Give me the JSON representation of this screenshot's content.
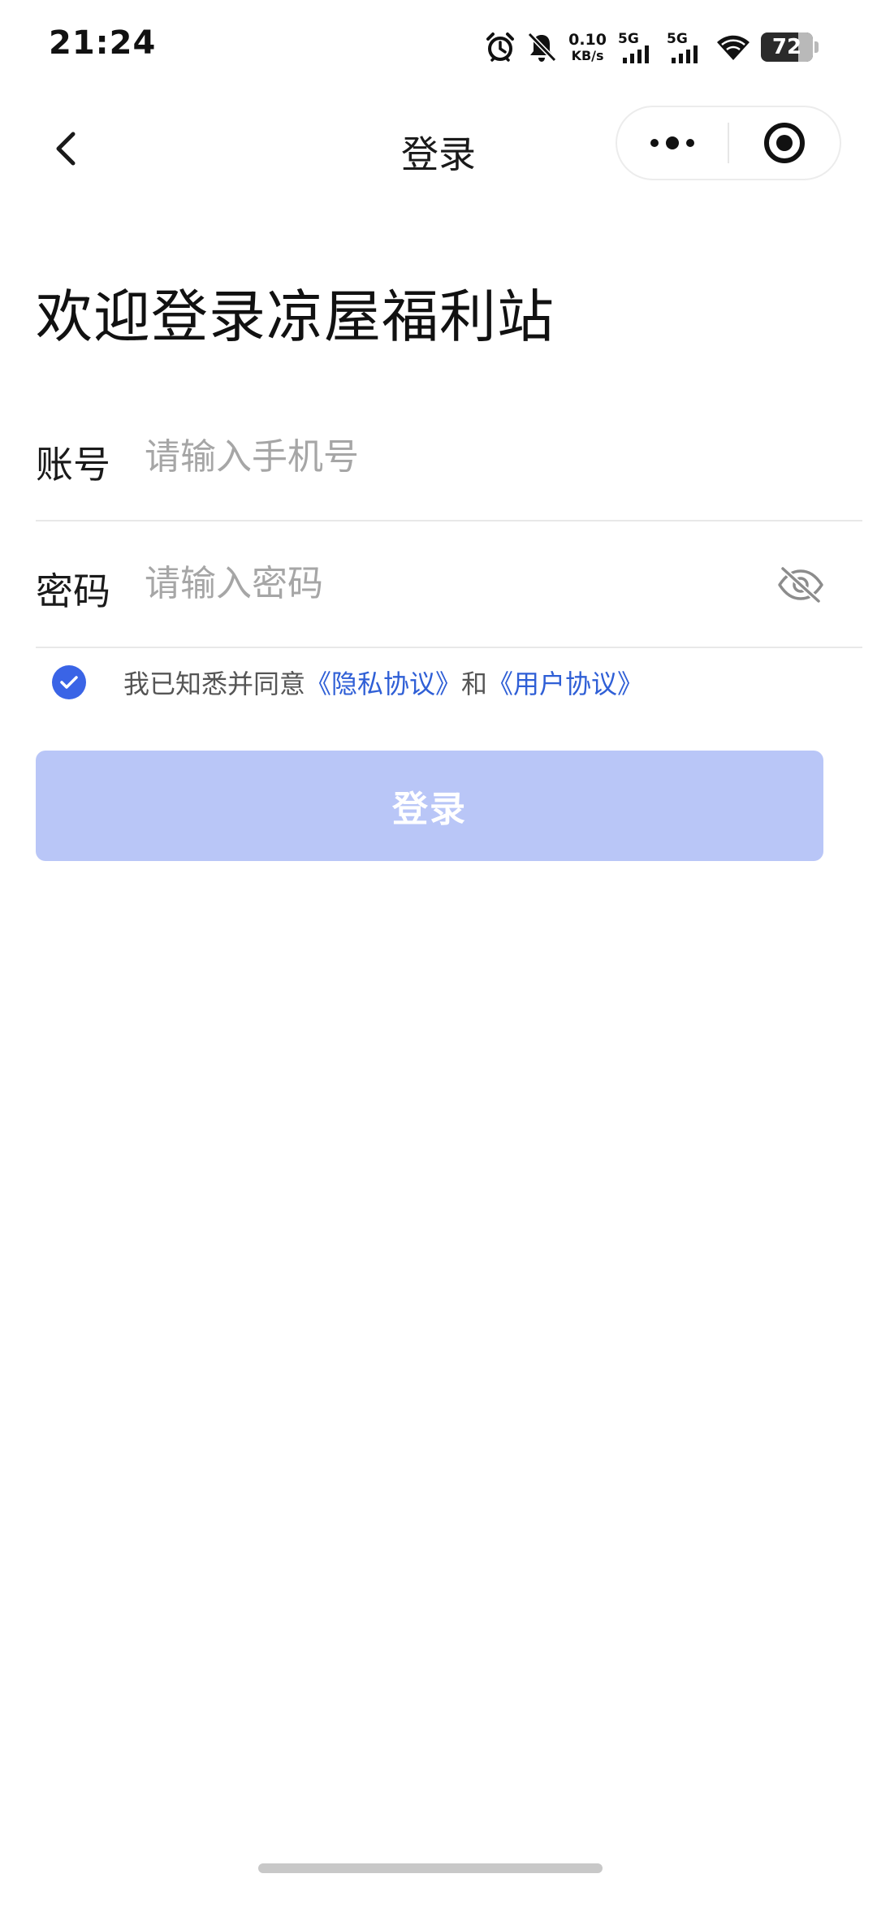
{
  "status_bar": {
    "time": "21:24",
    "net_speed_value": "0.10",
    "net_speed_unit": "KB/s",
    "sim1_label": "5G",
    "sim2_label": "5G",
    "battery_level": "72",
    "icons": [
      "alarm-icon",
      "bell-muted-icon",
      "signal-icon",
      "wifi-icon",
      "battery-icon"
    ]
  },
  "nav": {
    "title": "登录",
    "back_icon": "chevron-left-icon",
    "more_icon": "more-dots-icon",
    "close_icon": "target-circle-icon"
  },
  "page": {
    "welcome_title": "欢迎登录凉屋福利站"
  },
  "form": {
    "account": {
      "label": "账号",
      "placeholder": "请输入手机号",
      "value": ""
    },
    "password": {
      "label": "密码",
      "placeholder": "请输入密码",
      "value": "",
      "visibility_icon": "eye-hidden-icon"
    }
  },
  "agreement": {
    "checked": true,
    "prefix": "我已知悉并同意",
    "privacy_link": "《隐私协议》",
    "connector": "和",
    "user_link": "《用户协议》"
  },
  "login_button": {
    "label": "登录",
    "color": "#b9c6f7"
  },
  "colors": {
    "accent": "#3a64e6",
    "link": "#2f5fd6"
  }
}
